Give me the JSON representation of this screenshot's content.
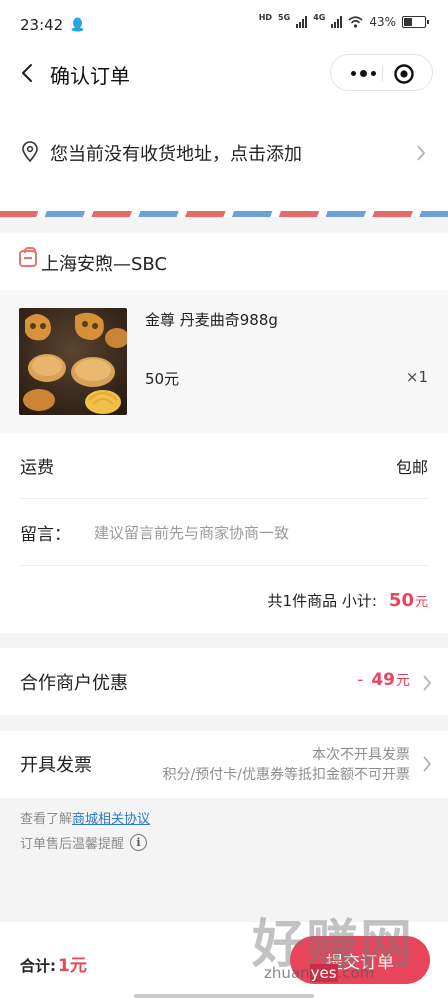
{
  "status_bar": {
    "time": "23:42",
    "qq_icon": "qq-penguin-icon",
    "hd_label": "HD",
    "net1": "5G",
    "net2": "4G",
    "battery": "43%",
    "battery_level": 0.43
  },
  "header": {
    "title": "确认订单",
    "back_icon": "chevron-left-icon",
    "more_icon": "more-dots-icon",
    "close_icon": "target-close-icon"
  },
  "address": {
    "icon": "location-pin-icon",
    "text": "您当前没有收货地址，点击添加"
  },
  "shop": {
    "icon": "shop-bag-icon",
    "name": "上海安煦—SBC"
  },
  "product": {
    "name": "金尊 丹麦曲奇988g",
    "price": "50元",
    "quantity": "×1"
  },
  "order": {
    "shipping_label": "运费",
    "shipping_value": "包邮",
    "remark_label": "留言：",
    "remark_placeholder": "建议留言前先与商家协商一致",
    "count_text": "共1件商品 小计:",
    "subtotal_amount": "50",
    "subtotal_unit": "元"
  },
  "discount": {
    "label": "合作商户优惠",
    "sign": "-",
    "amount": "49",
    "unit": "元"
  },
  "invoice": {
    "label": "开具发票",
    "line1": "本次不开具发票",
    "line2": "积分/预付卡/优惠券等抵扣金额不可开票"
  },
  "notes": {
    "prefix": "查看了解",
    "link": "商城相关协议",
    "tip": "订单售后温馨提醒",
    "info_icon": "info-circle-icon"
  },
  "bottom": {
    "total_label": "合计:",
    "total_amount": "1元",
    "submit_label": "提交订单"
  },
  "watermark": {
    "title": "好赚网",
    "url_prefix": "zhuan",
    "url_highlight": "yes",
    "url_suffix": ".com"
  },
  "colors": {
    "accent": "#e8455c",
    "link": "#2a78c9",
    "stripe_red": "#e66a6a",
    "stripe_blue": "#6e9fd8"
  }
}
